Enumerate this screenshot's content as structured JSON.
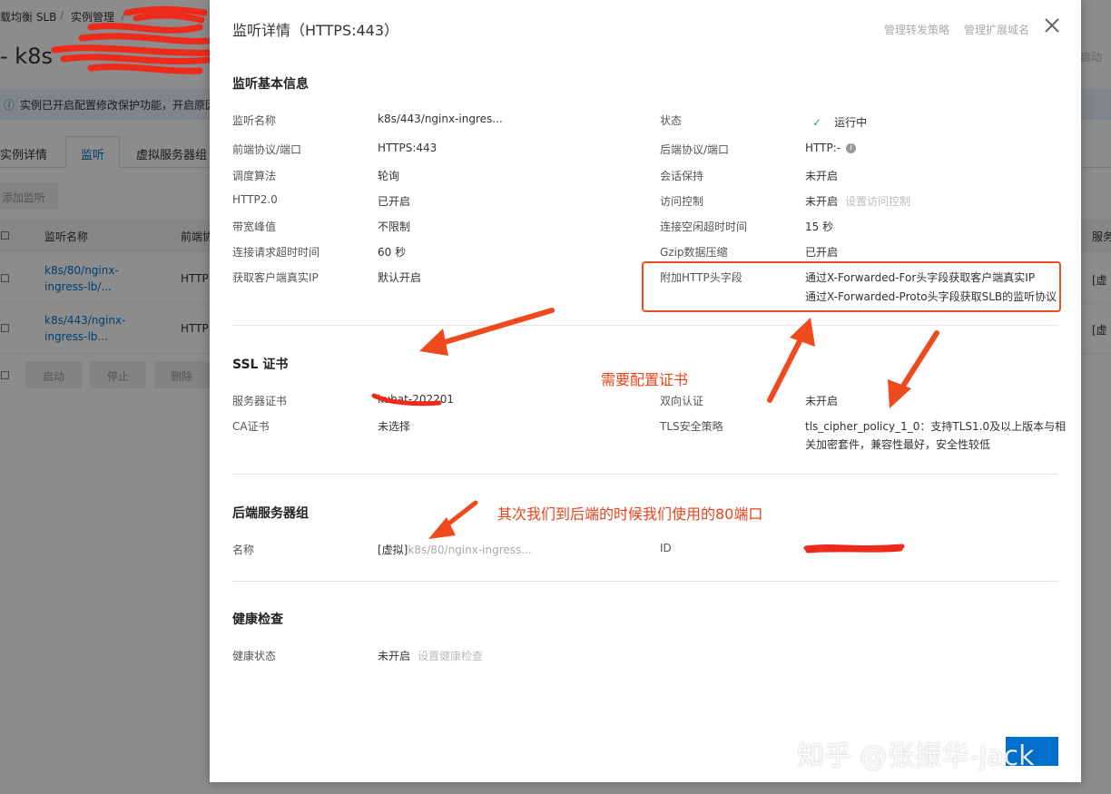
{
  "background": {
    "breadcrumb": [
      "载均衡 SLB",
      "/",
      "实例管理",
      "/"
    ],
    "instance_title": "k8s",
    "notice": "实例已开启配置修改保护功能，开启原因",
    "tabs": [
      "实例详情",
      "监听",
      "虚拟服务器组"
    ],
    "active_tab": "监听",
    "add_listener": "添加监听",
    "table_headers": [
      "监听名称",
      "前端协"
    ],
    "right_header": "服务",
    "rows": [
      {
        "name_line1": "k8s/80/nginx-",
        "name_line2": "ingress-lb/...",
        "proto": "HTTP",
        "right": "[虚"
      },
      {
        "name_line1": "k8s/443/nginx-",
        "name_line2": "ingress-lb...",
        "proto": "HTTP",
        "right": "[虚"
      }
    ],
    "actions": [
      "启动",
      "停止",
      "删除"
    ],
    "top_right_btn": "启动"
  },
  "modal": {
    "title": "监听详情（HTTPS:443）",
    "header_links": [
      "管理转发策略",
      "管理扩展域名"
    ],
    "basic": {
      "section": "监听基本信息",
      "left": [
        {
          "label": "监听名称",
          "value": "k8s/443/nginx-ingres..."
        },
        {
          "label": "前端协议/端口",
          "value": "HTTPS:443"
        },
        {
          "label": "调度算法",
          "value": "轮询"
        },
        {
          "label": "HTTP2.0",
          "value": "已开启"
        },
        {
          "label": "带宽峰值",
          "value": "不限制"
        },
        {
          "label": "连接请求超时时间",
          "value": "60 秒"
        },
        {
          "label": "获取客户端真实IP",
          "value": "默认开启"
        }
      ],
      "status_label": "状态",
      "status_value": "运行中",
      "backend_label": "后端协议/端口",
      "backend_value": "HTTP:-",
      "session_label": "会话保持",
      "session_value": "未开启",
      "acl_label": "访问控制",
      "acl_value": "未开启",
      "acl_action": "设置访问控制",
      "idle_label": "连接空闲超时时间",
      "idle_value": "15 秒",
      "gzip_label": "Gzip数据压缩",
      "gzip_value": "已开启",
      "header_label": "附加HTTP头字段",
      "header_line1": "通过X-Forwarded-For头字段获取客户端真实IP",
      "header_line2": "通过X-Forwarded-Proto头字段获取SLB的监听协议"
    },
    "ssl": {
      "section": "SSL 证书",
      "server_cert_label": "服务器证书",
      "server_cert_value": "kubat-202201",
      "ca_label": "CA证书",
      "ca_value": "未选择",
      "mutual_label": "双向认证",
      "mutual_value": "未开启",
      "tls_label": "TLS安全策略",
      "tls_line1": "tls_cipher_policy_1_0：支持TLS1.0及以上版本与相",
      "tls_line2": "关加密套件，兼容性最好，安全性较低"
    },
    "backend": {
      "section": "后端服务器组",
      "name_label": "名称",
      "name_prefix": "[虚拟]",
      "name_value": "k8s/80/nginx-ingress...",
      "id_label": "ID"
    },
    "health": {
      "section": "健康检查",
      "status_label": "健康状态",
      "status_value": "未开启",
      "action": "设置健康检查"
    }
  },
  "annotations": {
    "need_cert": "需要配置证书",
    "backend_port": "其次我们到后端的时候我们使用的80端口"
  },
  "watermark": "知乎 @张振华-Jack",
  "colors": {
    "accent": "#0070cc",
    "annotation": "#e8431a"
  }
}
